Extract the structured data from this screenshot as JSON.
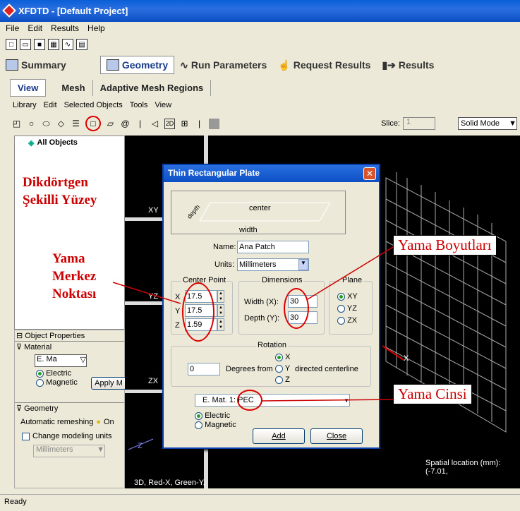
{
  "window": {
    "title": "XFDTD - [Default Project]"
  },
  "menubar": [
    "File",
    "Edit",
    "Results",
    "Help"
  ],
  "mode_tabs": [
    {
      "label": "Summary",
      "icon": "summary-icon"
    },
    {
      "label": "Geometry",
      "icon": "geometry-icon"
    },
    {
      "label": "Run Parameters",
      "icon": "run-parameters-icon"
    },
    {
      "label": "Request Results",
      "icon": "request-results-icon"
    },
    {
      "label": "Results",
      "icon": "results-icon"
    }
  ],
  "sub_tabs": [
    "View",
    "Mesh",
    "Adaptive Mesh Regions"
  ],
  "menu2": [
    "Library",
    "Edit",
    "Selected Objects",
    "Tools",
    "View"
  ],
  "slice": {
    "label": "Slice:",
    "value": "1"
  },
  "view_mode": "Solid Mode",
  "tree": {
    "root": "All Objects"
  },
  "left_panel": {
    "object_properties": "Object Properties",
    "material": "Material",
    "material_value": "E. Ma",
    "electric": "Electric",
    "magnetic": "Magnetic",
    "apply": "Apply M",
    "geometry": "Geometry",
    "auto_remesh": "Automatic remeshing",
    "auto_remesh_value": "On",
    "change_units": "Change modeling units",
    "units": "Millimeters"
  },
  "canvas": {
    "labels": {
      "xy": "XY",
      "yz": "YZ",
      "zx": "ZX",
      "z_axis": "Z",
      "x_axis": "X"
    },
    "spatial": "Spatial location (mm): (-7.01,",
    "view_info": "3D, Red-X, Green-Y,"
  },
  "dialog": {
    "title": "Thin Rectangular Plate",
    "preview": {
      "center": "center",
      "depth": "depth",
      "width": "width"
    },
    "name_label": "Name:",
    "name_value": "Ana Patch",
    "units_label": "Units:",
    "units_value": "Millimeters",
    "center_point": {
      "title": "Center Point",
      "labels": [
        "X",
        "Y",
        "Z"
      ],
      "values": [
        "17.5",
        "17.5",
        "1.59"
      ]
    },
    "dimensions": {
      "title": "Dimensions",
      "width_label": "Width (X):",
      "width_value": "30",
      "depth_label": "Depth (Y):",
      "depth_value": "30"
    },
    "plane": {
      "title": "Plane",
      "options": [
        "XY",
        "YZ",
        "ZX"
      ],
      "selected": "XY"
    },
    "rotation": {
      "title": "Rotation",
      "value": "0",
      "degrees_from": "Degrees from",
      "directed": "directed centerline",
      "options": [
        "X",
        "Y",
        "Z"
      ],
      "selected": "X"
    },
    "material_value": "E. Mat. 1: PEC",
    "electric": "Electric",
    "magnetic": "Magnetic",
    "add": "Add",
    "close": "Close"
  },
  "annotations": {
    "shape_line1": "Dikdörtgen",
    "shape_line2": "Şekilli Yüzey",
    "center_line1": "Yama",
    "center_line2": "Merkez",
    "center_line3": "Noktası",
    "dimensions": "Yama Boyutları",
    "type": "Yama Cinsi"
  },
  "status": "Ready",
  "colors": {
    "annotation": "#cc0000",
    "titlebar": "#0b4fc4",
    "canvas": "#000000"
  }
}
